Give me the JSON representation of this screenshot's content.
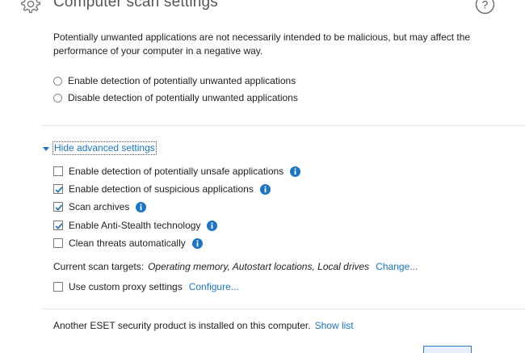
{
  "header": {
    "title": "Computer scan settings",
    "icon": "gear-icon",
    "help_icon": "question-mark-icon"
  },
  "description": "Potentially unwanted applications are not necessarily intended to be malicious, but may affect the performance of your computer in a negative way.",
  "pua_options": [
    {
      "label": "Enable detection of potentially unwanted applications",
      "selected": false
    },
    {
      "label": "Disable detection of potentially unwanted applications",
      "selected": false
    }
  ],
  "advanced": {
    "toggle_label": "Hide advanced settings",
    "options": [
      {
        "label": "Enable detection of potentially unsafe applications",
        "checked": false,
        "info": true
      },
      {
        "label": "Enable detection of suspicious applications",
        "checked": true,
        "info": true
      },
      {
        "label": "Scan archives",
        "checked": true,
        "info": true
      },
      {
        "label": "Enable Anti-Stealth technology",
        "checked": true,
        "info": true
      },
      {
        "label": "Clean threats automatically",
        "checked": false,
        "info": true
      }
    ],
    "scan_targets_label": "Current scan targets:",
    "scan_targets_value": "Operating memory, Autostart locations, Local drives",
    "scan_targets_link": "Change...",
    "proxy_label": "Use custom proxy settings",
    "proxy_checked": false,
    "proxy_link": "Configure..."
  },
  "footer": {
    "message": "Another ESET security product is installed on this computer.",
    "link": "Show list"
  },
  "colors": {
    "link": "#1a75c4",
    "info_icon": "#1a75c4",
    "check": "#2a6fb8"
  }
}
